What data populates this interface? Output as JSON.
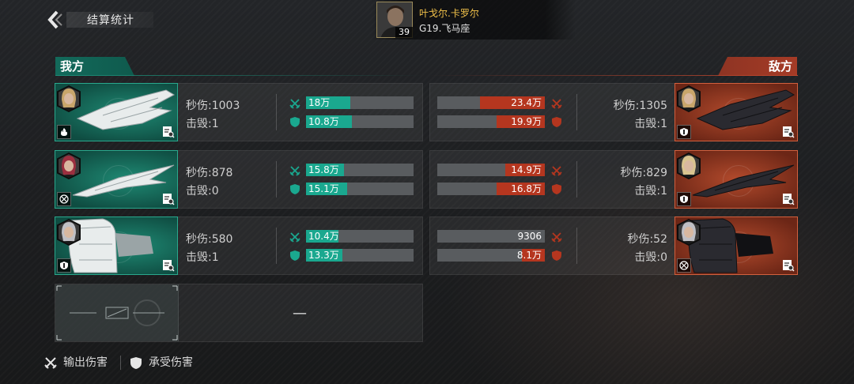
{
  "header": {
    "title": "结算统计",
    "player": {
      "name": "叶戈尔.卡罗尔",
      "level": "39",
      "server": "G19.飞马座"
    }
  },
  "sides": {
    "ours": "我方",
    "enemy": "敌方"
  },
  "labels": {
    "dps": "秒伤:",
    "kills": "击毁:",
    "empty": "—"
  },
  "ours": [
    {
      "dps": "1003",
      "kills": "1",
      "dealt": "18万",
      "dealt_ratio": 0.41,
      "taken": "10.8万",
      "taken_ratio": 0.43,
      "pilot_color": "#c9a66b",
      "type_icon": "flame-icon"
    },
    {
      "dps": "878",
      "kills": "0",
      "dealt": "15.8万",
      "dealt_ratio": 0.35,
      "taken": "15.1万",
      "taken_ratio": 0.38,
      "pilot_color": "#9b2f3f",
      "type_icon": "crosshair-icon"
    },
    {
      "dps": "580",
      "kills": "1",
      "dealt": "10.4万",
      "dealt_ratio": 0.3,
      "taken": "13.3万",
      "taken_ratio": 0.34,
      "pilot_color": "#bfbfc4",
      "type_icon": "shield-badge-icon"
    }
  ],
  "enemy": [
    {
      "dps": "1305",
      "kills": "1",
      "dealt": "23.4万",
      "dealt_ratio": 0.6,
      "taken": "19.9万",
      "taken_ratio": 0.45,
      "pilot_color": "#c9a66b",
      "type_icon": "shield-badge-icon"
    },
    {
      "dps": "829",
      "kills": "1",
      "dealt": "14.9万",
      "dealt_ratio": 0.37,
      "taken": "16.8万",
      "taken_ratio": 0.45,
      "pilot_color": "#d9c48f",
      "type_icon": "shield-badge-icon"
    },
    {
      "dps": "52",
      "kills": "0",
      "dealt": "9306",
      "dealt_ratio": 0.0,
      "taken": "8.1万",
      "taken_ratio": 0.21,
      "pilot_color": "#bfbfc4",
      "type_icon": "crosshair-icon"
    }
  ],
  "legend": {
    "dealt": "输出伤害",
    "taken": "承受伤害"
  },
  "colors": {
    "ours_accent": "#1aa88f",
    "enemy_accent": "#b5361f",
    "player_name": "#f3c24a"
  }
}
